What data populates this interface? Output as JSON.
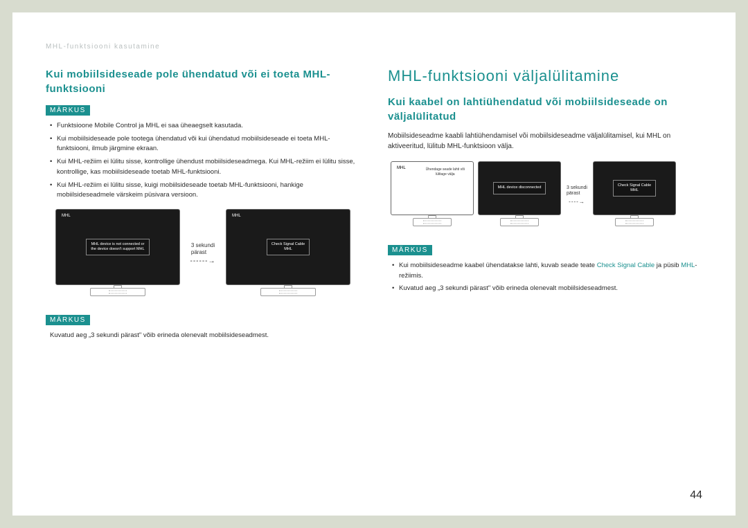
{
  "header": "MHL-funktsiooni kasutamine",
  "page_number": "44",
  "left": {
    "title": "Kui mobiilsideseade pole ühendatud või ei toeta MHL-funktsiooni",
    "markus_label": "MÄRKUS",
    "notes1": [
      "Funktsioone Mobile Control ja MHL ei saa üheaegselt kasutada.",
      "Kui mobiilsideseade pole tootega ühendatud või kui ühendatud mobiilsideseade ei toeta MHL-funktsiooni, ilmub järgmine ekraan.",
      "Kui MHL-režiim ei lülitu sisse, kontrollige ühendust mobiilsideseadmega. Kui MHL-režiim ei lülitu sisse, kontrollige, kas mobiilsideseade toetab MHL-funktsiooni.",
      "Kui MHL-režiim ei lülitu sisse, kuigi mobiilsideseade toetab MHL-funktsiooni, hankige mobiilsideseadmele värskeim püsivara versioon."
    ],
    "arrow_label": "3 sekundi\npärast",
    "monitor1": {
      "tag": "MHL",
      "msg": "MHL device is not connected or\nthe device doesn't support MHL"
    },
    "monitor2": {
      "tag": "MHL",
      "msg": "Check Signal Cable\nMHL"
    },
    "note_after": "Kuvatud aeg „3 sekundi pärast\" võib erineda olenevalt mobiilsideseadmest."
  },
  "right": {
    "title_big": "MHL-funktsiooni väljalülitamine",
    "subtitle": "Kui kaabel on lahtiühendatud või mobiilsideseade on väljalülitatud",
    "body": "Mobiilsideseadme kaabli lahtiühendamisel või mobiilsideseadme väljalülitamisel, kui MHL on aktiveeritud, lülitub MHL-funktsioon välja.",
    "monitor1": {
      "tag": "MHL",
      "msg": "Ühendage seade lahti või\nlülitage välja"
    },
    "monitor2": {
      "msg": "MHL device disconnected"
    },
    "arrow_label": "3 sekundi\npärast",
    "monitor3": {
      "msg": "Check Signal Cable\nMHL"
    },
    "markus_label": "MÄRKUS",
    "notes": {
      "line1_pre": "Kui mobiilsideseadme kaabel ühendatakse lahti, kuvab seade teate ",
      "accent1": "Check Signal Cable",
      "mid": " ja püsib ",
      "accent2": "MHL",
      "post": "-režiimis.",
      "line2": "Kuvatud aeg „3 sekundi pärast\" võib erineda olenevalt mobiilsideseadmest."
    }
  }
}
